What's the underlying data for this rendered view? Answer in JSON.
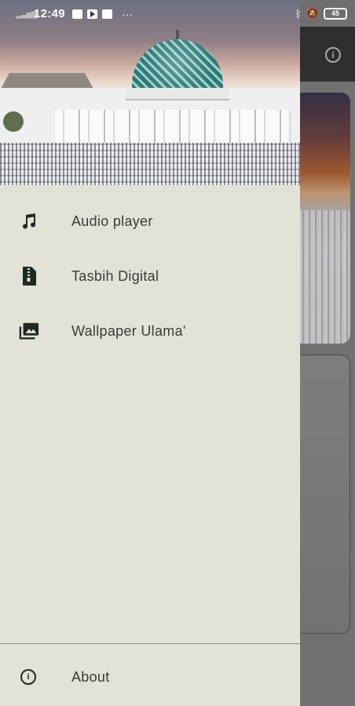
{
  "status_bar": {
    "time": "12:49",
    "battery": "45",
    "more": "···",
    "colors": {
      "text": "#ffffff"
    }
  },
  "drawer": {
    "header_image": "mosque-header-image",
    "items": [
      {
        "label": "Audio player",
        "icon": "music-note-icon"
      },
      {
        "label": "Tasbih Digital",
        "icon": "zip-file-icon"
      },
      {
        "label": "Wallpaper Ulama'",
        "icon": "photo-library-icon"
      }
    ],
    "footer": {
      "label": "About",
      "icon": "info-icon"
    },
    "colors": {
      "background": "#e3e2d6",
      "text": "#3a3a3a",
      "icon": "#1e2a24"
    }
  },
  "background_app": {
    "appbar_action": "info-icon"
  }
}
